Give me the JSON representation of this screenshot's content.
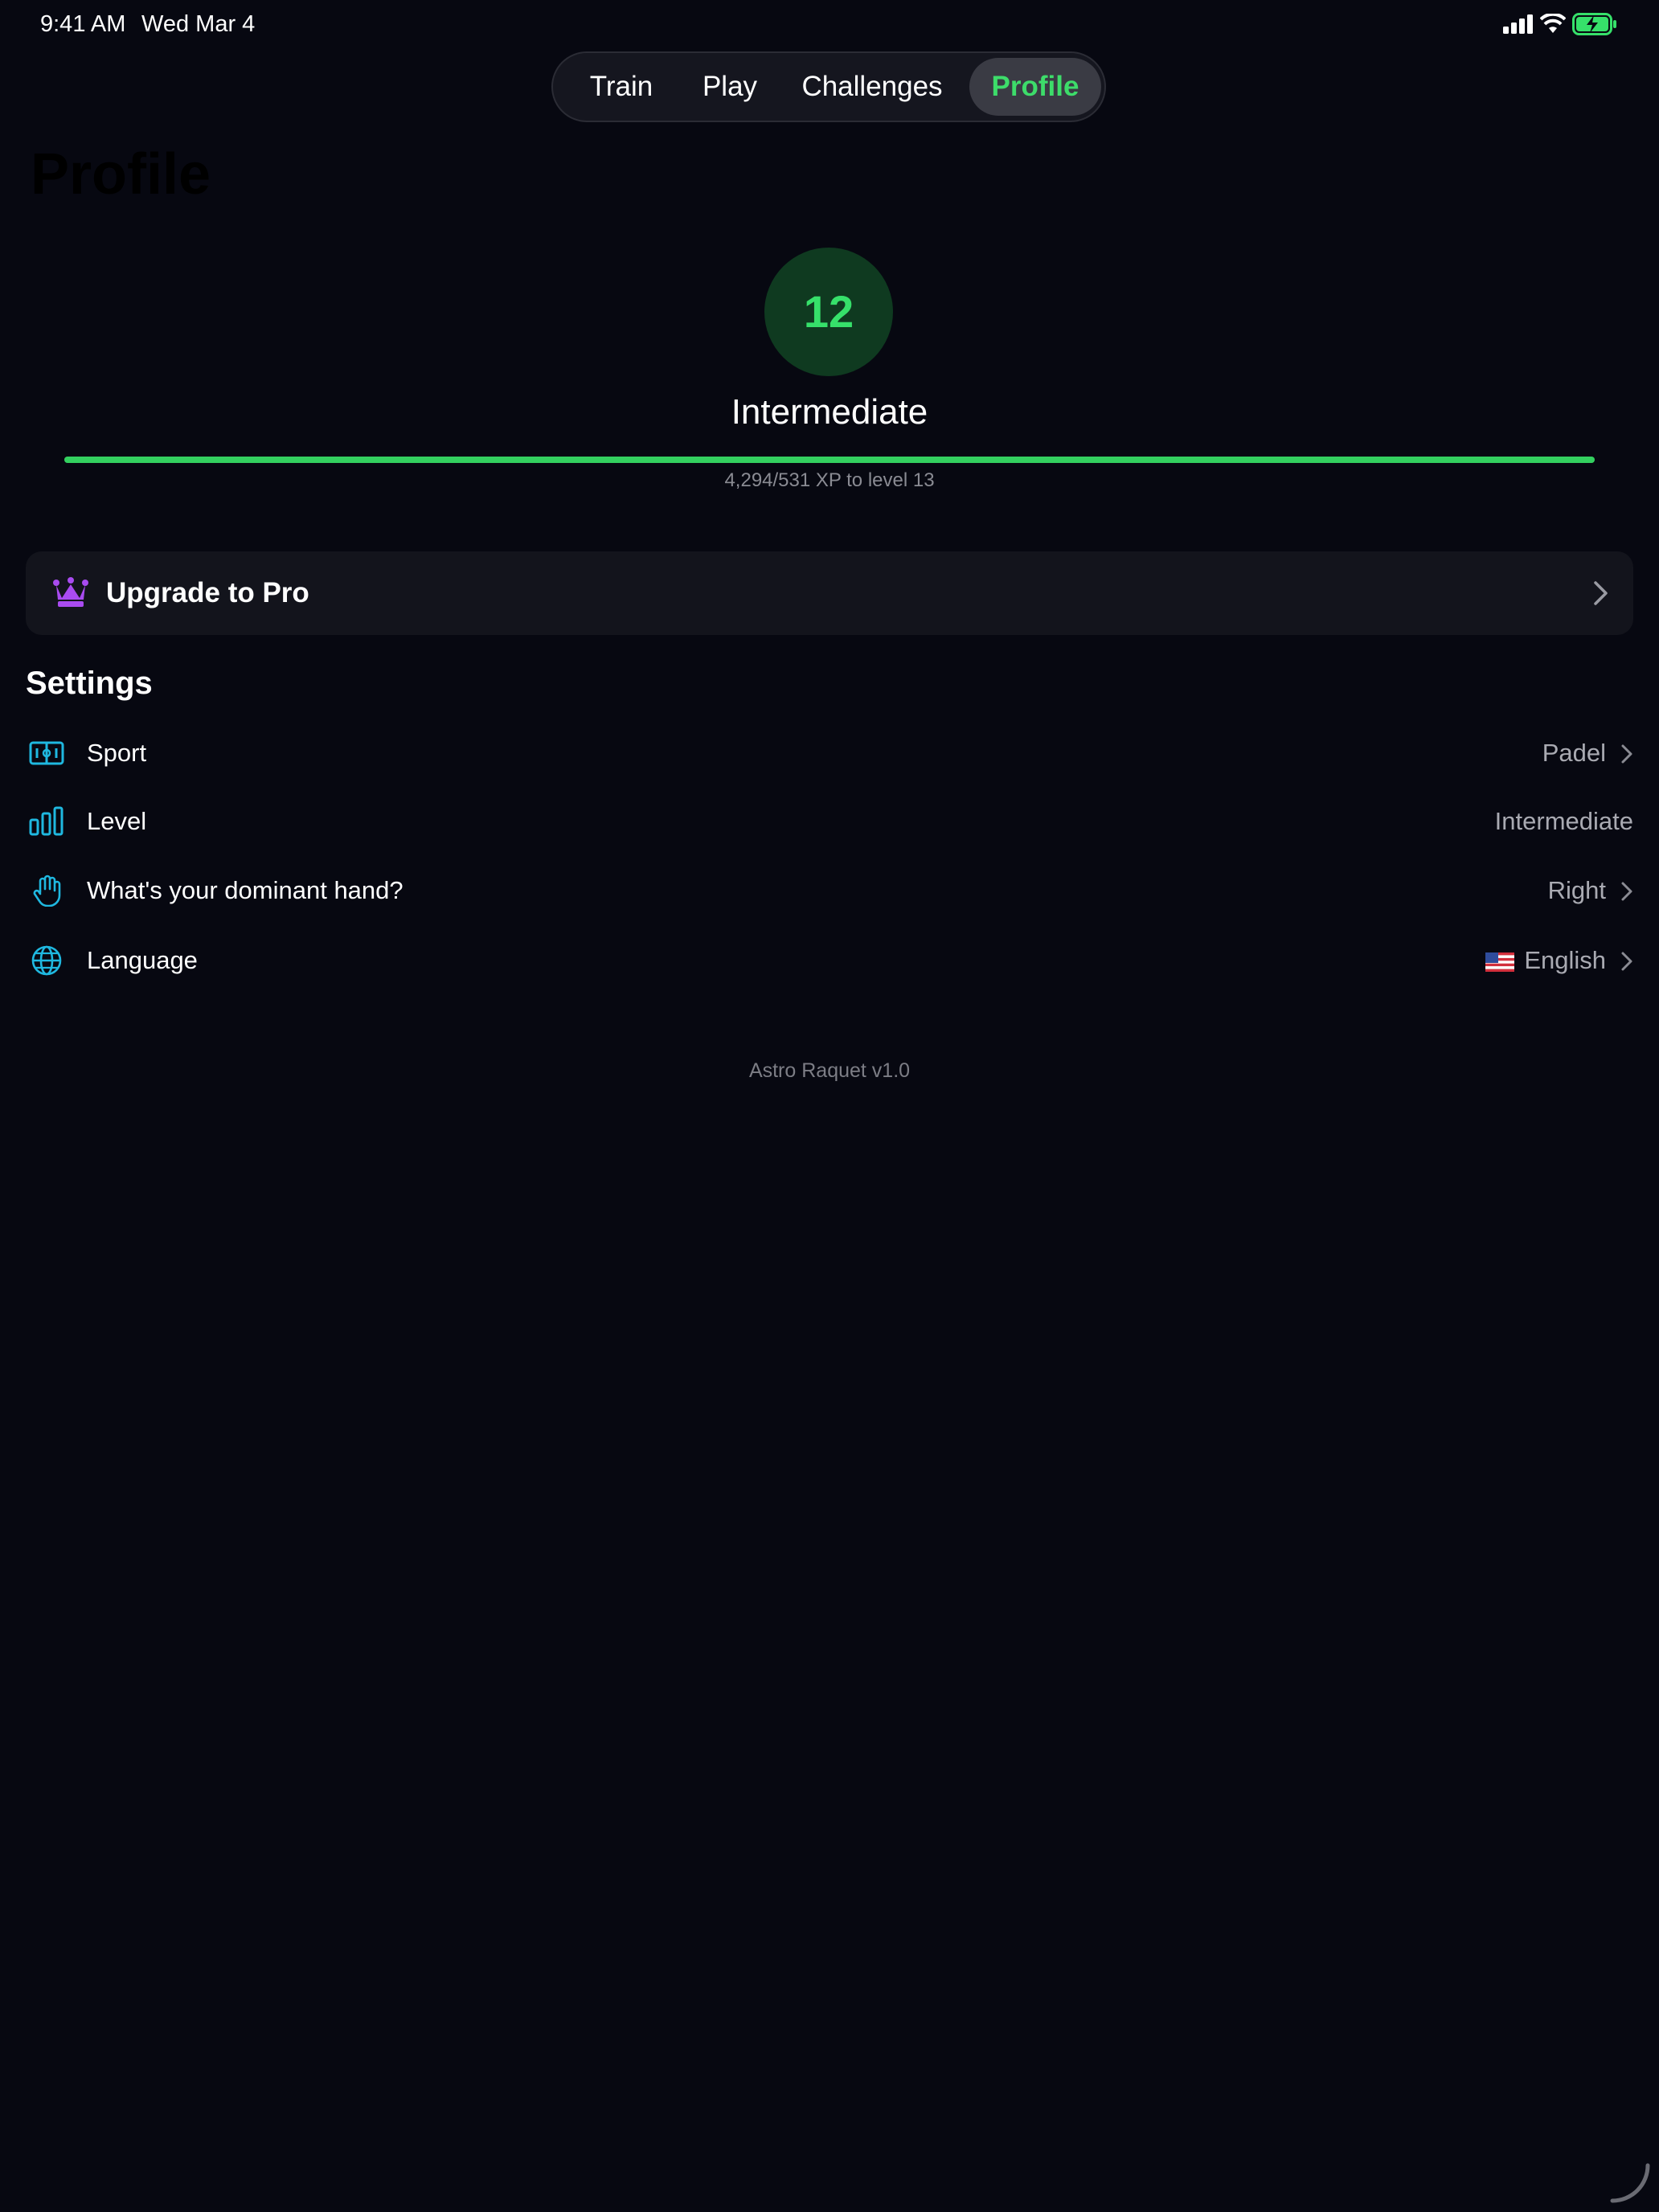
{
  "status_bar": {
    "time": "9:41 AM",
    "date": "Wed Mar 4",
    "icons": [
      "cellular-signal-icon",
      "wifi-icon",
      "battery-charging-icon"
    ]
  },
  "nav": {
    "tabs": [
      {
        "label": "Train",
        "active": false
      },
      {
        "label": "Play",
        "active": false
      },
      {
        "label": "Challenges",
        "active": false
      },
      {
        "label": "Profile",
        "active": true
      }
    ]
  },
  "page": {
    "title": "Profile"
  },
  "profile": {
    "level_number": "12",
    "level_name": "Intermediate",
    "xp_progress_fraction": 1.0,
    "xp_text": "4,294/531 XP to level 13"
  },
  "upgrade": {
    "label": "Upgrade to Pro",
    "icon": "crown-icon"
  },
  "settings": {
    "heading": "Settings",
    "items": [
      {
        "icon": "court-icon",
        "label": "Sport",
        "value": "Padel",
        "has_chevron": true
      },
      {
        "icon": "bar-levels-icon",
        "label": "Level",
        "value": "Intermediate",
        "has_chevron": false
      },
      {
        "icon": "hand-icon",
        "label": "What's your dominant hand?",
        "value": "Right",
        "has_chevron": true
      },
      {
        "icon": "globe-icon",
        "label": "Language",
        "value": "English",
        "flag": "us-flag-icon",
        "has_chevron": true
      }
    ]
  },
  "footer": {
    "version": "Astro Raquet v1.0"
  },
  "colors": {
    "background": "#070811",
    "accent_green": "#36e06a",
    "icon_cyan": "#1fb8e0",
    "crown_purple": "#a94bf0",
    "card": "#13141c"
  }
}
